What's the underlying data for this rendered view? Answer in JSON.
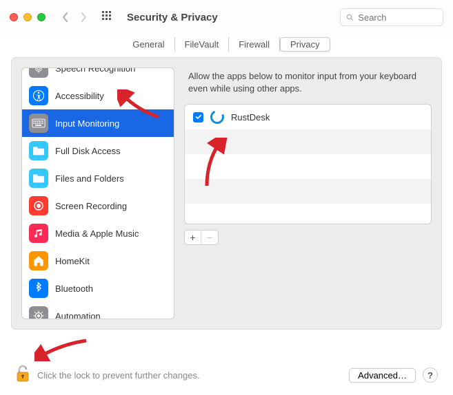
{
  "header": {
    "title": "Security & Privacy",
    "search_placeholder": "Search"
  },
  "tabs": [
    {
      "label": "General",
      "active": false
    },
    {
      "label": "FileVault",
      "active": false
    },
    {
      "label": "Firewall",
      "active": false
    },
    {
      "label": "Privacy",
      "active": true
    }
  ],
  "sidebar": {
    "items": [
      {
        "label": "Speech Recognition",
        "icon": "speech",
        "selected": false,
        "bg": "#8e8e93"
      },
      {
        "label": "Accessibility",
        "icon": "accessibility",
        "selected": false,
        "bg": "#007aff"
      },
      {
        "label": "Input Monitoring",
        "icon": "keyboard",
        "selected": true,
        "bg": "#8e8e93"
      },
      {
        "label": "Full Disk Access",
        "icon": "folder",
        "selected": false,
        "bg": "#34c7fc"
      },
      {
        "label": "Files and Folders",
        "icon": "folder",
        "selected": false,
        "bg": "#34c7fc"
      },
      {
        "label": "Screen Recording",
        "icon": "record",
        "selected": false,
        "bg": "#ff3b30"
      },
      {
        "label": "Media & Apple Music",
        "icon": "music",
        "selected": false,
        "bg": "#fc2a55"
      },
      {
        "label": "HomeKit",
        "icon": "home",
        "selected": false,
        "bg": "#ff9500"
      },
      {
        "label": "Bluetooth",
        "icon": "bluetooth",
        "selected": false,
        "bg": "#007aff"
      },
      {
        "label": "Automation",
        "icon": "automation",
        "selected": false,
        "bg": "#8e8e93"
      }
    ]
  },
  "right": {
    "description": "Allow the apps below to monitor input from your keyboard even while using other apps.",
    "apps": [
      {
        "name": "RustDesk",
        "checked": true
      }
    ]
  },
  "footer": {
    "lock_text": "Click the lock to prevent further changes.",
    "advanced": "Advanced…",
    "help": "?"
  }
}
